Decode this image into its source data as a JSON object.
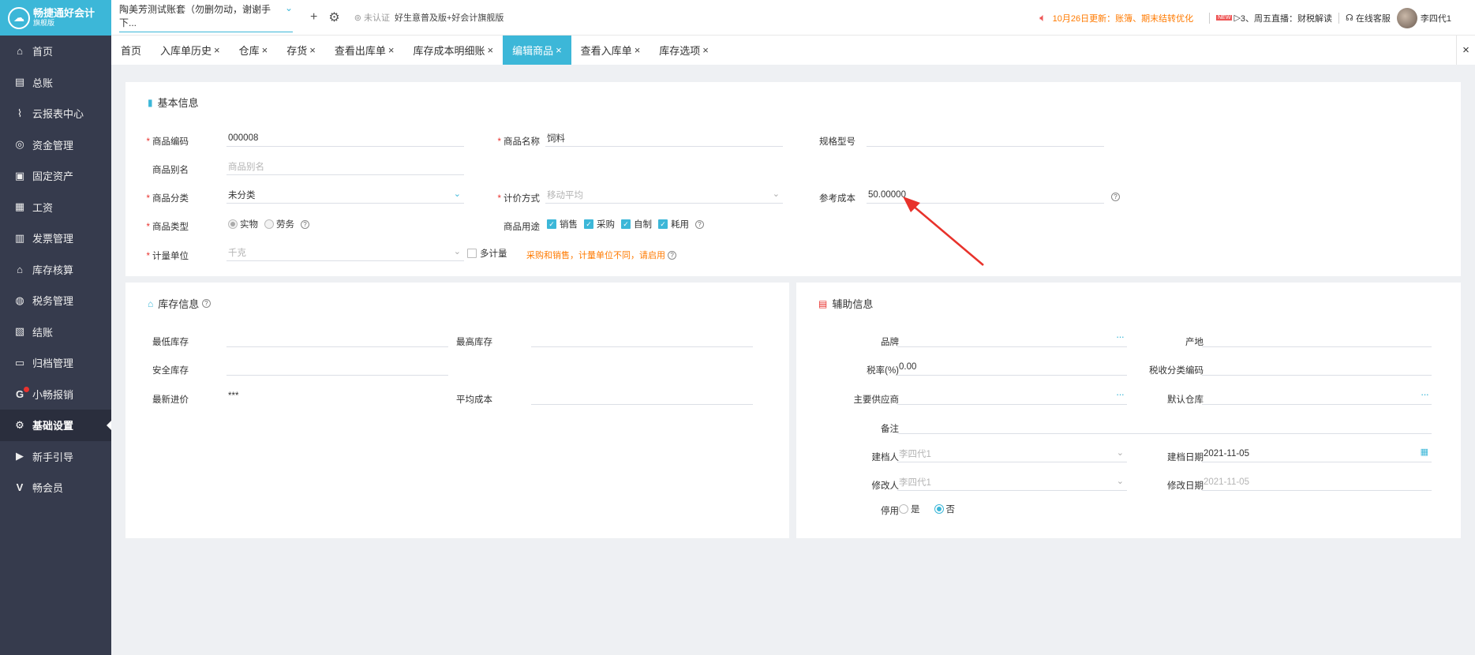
{
  "app": {
    "logo_title": "畅捷通好会计",
    "logo_sub": "旗舰版"
  },
  "sidebar": {
    "items": [
      {
        "label": "首页",
        "icon": "home-icon"
      },
      {
        "label": "总账",
        "icon": "ledger-icon"
      },
      {
        "label": "云报表中心",
        "icon": "chart-icon"
      },
      {
        "label": "资金管理",
        "icon": "money-icon"
      },
      {
        "label": "固定资产",
        "icon": "asset-icon"
      },
      {
        "label": "工资",
        "icon": "salary-icon"
      },
      {
        "label": "发票管理",
        "icon": "invoice-icon"
      },
      {
        "label": "库存核算",
        "icon": "warehouse-icon"
      },
      {
        "label": "税务管理",
        "icon": "tax-icon"
      },
      {
        "label": "结账",
        "icon": "checkout-icon"
      },
      {
        "label": "归档管理",
        "icon": "archive-icon"
      },
      {
        "label": "小畅报销",
        "icon": "reimburse-icon"
      },
      {
        "label": "基础设置",
        "icon": "gear-icon"
      },
      {
        "label": "新手引导",
        "icon": "guide-icon"
      },
      {
        "label": "畅会员",
        "icon": "vip-icon"
      }
    ]
  },
  "topbar": {
    "account": "陶美芳测试账套（勿删勿动，谢谢手下...",
    "auth_status": "未认证",
    "edition": "好生意普及版+好会计旗舰版",
    "notice": "10月26日更新：账簿、期末结转优化",
    "live_badge": "NEW",
    "live": "3、周五直播：财税解读",
    "service": "在线客服",
    "user": "李四代1"
  },
  "tabs": [
    {
      "label": "首页",
      "closable": false
    },
    {
      "label": "入库单历史",
      "closable": true
    },
    {
      "label": "仓库",
      "closable": true
    },
    {
      "label": "存货",
      "closable": true
    },
    {
      "label": "查看出库单",
      "closable": true
    },
    {
      "label": "库存成本明细账",
      "closable": true
    },
    {
      "label": "编辑商品",
      "closable": true,
      "active": true
    },
    {
      "label": "查看入库单",
      "closable": true
    },
    {
      "label": "库存选项",
      "closable": true
    }
  ],
  "basic": {
    "title": "基本信息",
    "code_label": "商品编码",
    "code_value": "000008",
    "name_label": "商品名称",
    "name_value": "饲料",
    "spec_label": "规格型号",
    "spec_value": "",
    "alias_label": "商品别名",
    "alias_placeholder": "商品别名",
    "category_label": "商品分类",
    "category_value": "未分类",
    "pricing_label": "计价方式",
    "pricing_value": "移动平均",
    "refcost_label": "参考成本",
    "refcost_value": "50.00000",
    "type_label": "商品类型",
    "type_options": [
      "实物",
      "劳务"
    ],
    "usage_label": "商品用途",
    "usage_options": [
      "销售",
      "采购",
      "自制",
      "耗用"
    ],
    "unit_label": "计量单位",
    "unit_value": "千克",
    "multi_unit": "多计量",
    "unit_hint": "采购和销售，计量单位不同，请启用"
  },
  "stock": {
    "title": "库存信息",
    "min_label": "最低库存",
    "max_label": "最高库存",
    "safe_label": "安全库存",
    "last_price_label": "最新进价",
    "last_price_value": "***",
    "avg_cost_label": "平均成本"
  },
  "aux": {
    "title": "辅助信息",
    "brand_label": "品牌",
    "origin_label": "产地",
    "tax_label": "税率(%)",
    "tax_value": "0.00",
    "taxcode_label": "税收分类编码",
    "supplier_label": "主要供应商",
    "warehouse_label": "默认仓库",
    "remark_label": "备注",
    "creator_label": "建档人",
    "creator_value": "李四代1",
    "create_date_label": "建档日期",
    "create_date_value": "2021-11-05",
    "modifier_label": "修改人",
    "modifier_value": "李四代1",
    "modify_date_label": "修改日期",
    "modify_date_value": "2021-11-05",
    "disable_label": "停用",
    "disable_yes": "是",
    "disable_no": "否"
  },
  "colors": {
    "accent": "#3cb7d8",
    "sidebar": "#363b4d",
    "required": "#e9322e",
    "notice": "#ff7a00",
    "arrow": "#e8322b"
  }
}
